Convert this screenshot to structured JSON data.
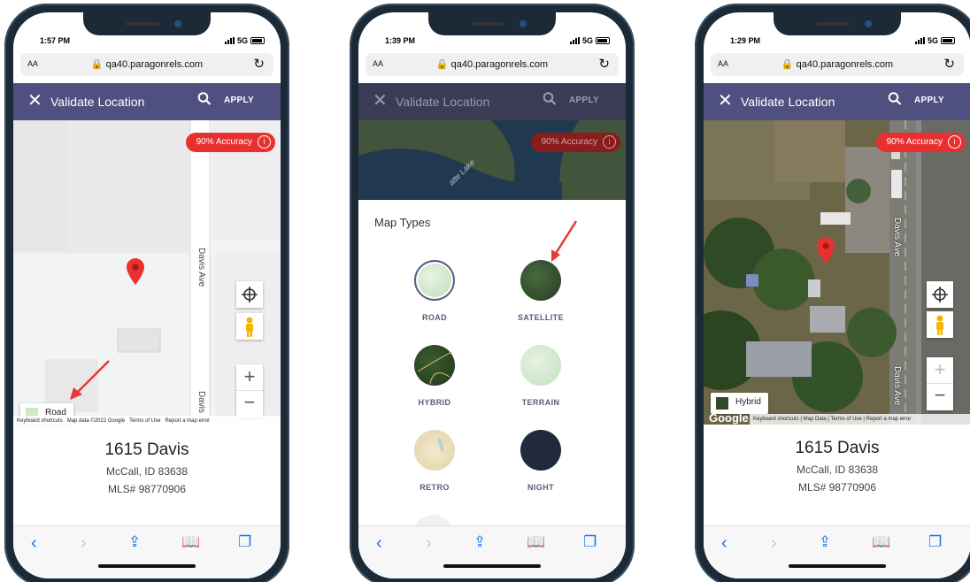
{
  "phones": [
    {
      "time": "1:57 PM",
      "network": "5G",
      "font_button": "AA",
      "url": "qa40.paragonrels.com",
      "title": "Validate Location",
      "apply": "APPLY",
      "accuracy": "90% Accuracy",
      "street_1": "Davis Ave",
      "street_2": "Davis",
      "map_type": "Road",
      "attribution": [
        "Keyboard shortcuts",
        "Map data ©2022 Google",
        "Terms of Use",
        "Report a map error"
      ],
      "address": {
        "street": "1615 Davis",
        "city": "McCall, ID 83638",
        "mls": "MLS# 98770906"
      }
    },
    {
      "time": "1:39 PM",
      "network": "5G",
      "font_button": "AA",
      "url": "qa40.paragonrels.com",
      "title": "Validate Location",
      "apply": "APPLY",
      "accuracy": "90% Accuracy",
      "lake_label": "atte Lake",
      "sheet_title": "Map Types",
      "map_types": [
        "ROAD",
        "SATELLITE",
        "HYBRID",
        "TERRAIN",
        "RETRO",
        "NIGHT"
      ],
      "selected_map_type": "ROAD"
    },
    {
      "time": "1:29 PM",
      "network": "5G",
      "font_button": "AA",
      "url": "qa40.paragonrels.com",
      "title": "Validate Location",
      "apply": "APPLY",
      "accuracy": "90% Accuracy",
      "street_1": "Davis Ave",
      "street_2": "Davis Ave",
      "map_type": "Hybrid",
      "attribution": [
        "Keyboard shortcuts",
        "Map Data",
        "Terms of Use",
        "Report a map error"
      ],
      "google_logo": "Google",
      "address": {
        "street": "1615 Davis",
        "city": "McCall, ID 83638",
        "mls": "MLS# 98770906"
      }
    }
  ],
  "colors": {
    "app_bar": "#4f5080",
    "accuracy_badge": "#e8302f",
    "ios_blue": "#1a73e8",
    "annotation_arrow": "#e53935",
    "pin": "#e8302f"
  },
  "icons": [
    "close-icon",
    "search-icon",
    "info-icon",
    "lock-icon",
    "reload-icon",
    "locate-icon",
    "pegman-icon",
    "zoom-in-icon",
    "zoom-out-icon",
    "back-icon",
    "forward-icon",
    "share-icon",
    "bookmarks-icon",
    "tabs-icon",
    "map-pin-icon"
  ]
}
